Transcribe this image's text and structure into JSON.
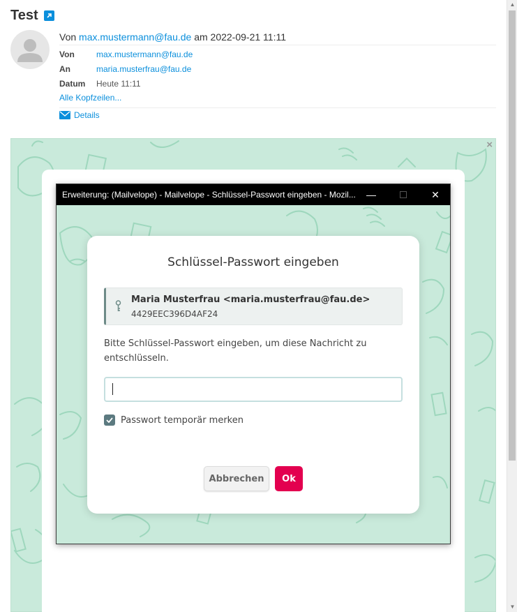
{
  "email": {
    "subject": "Test",
    "from_prefix": "Von",
    "from_address": "max.mustermann@fau.de",
    "from_suffix": "am 2022-09-21 11:11",
    "headers": [
      {
        "key": "Von",
        "value": "max.mustermann@fau.de"
      },
      {
        "key": "An",
        "value": "maria.musterfrau@fau.de"
      },
      {
        "key": "Datum",
        "value": "Heute 11:11"
      }
    ],
    "all_headers_link": "Alle Kopfzeilen...",
    "details_link": "Details"
  },
  "mailvelope": {
    "close_symbol": "×",
    "window": {
      "title": "Erweiterung: (Mailvelope) - Mailvelope - Schlüssel-Passwort eingeben - Mozil...",
      "minimize": "—",
      "maximize": "☐",
      "close": "✕"
    },
    "dialog": {
      "title": "Schlüssel-Passwort eingeben",
      "key_owner": "Maria Musterfrau <maria.musterfrau@fau.de>",
      "key_id": "4429EEC396D4AF24",
      "prompt": "Bitte Schlüssel-Passwort eingeben, um diese Nachricht zu entschlüsseln.",
      "password_value": "",
      "remember_label": "Passwort temporär merken",
      "remember_checked": true,
      "cancel_label": "Abbrechen",
      "ok_label": "Ok"
    }
  },
  "colors": {
    "link": "#0b8fdc",
    "mailvelope_bg": "#c9eadb",
    "ok_button": "#e3004f",
    "checkbox": "#5c7a80"
  }
}
